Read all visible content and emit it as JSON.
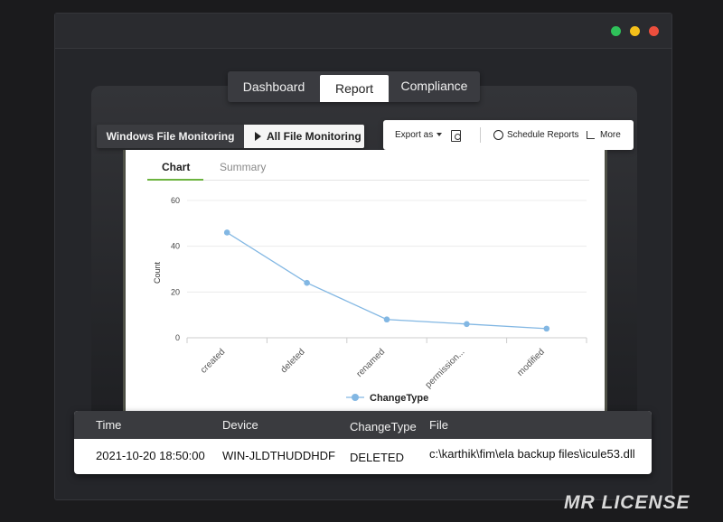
{
  "tabs": [
    {
      "label": "Dashboard",
      "active": false
    },
    {
      "label": "Report",
      "active": true
    },
    {
      "label": "Compliance",
      "active": false
    }
  ],
  "subtabs": {
    "windows_file_monitoring": "Windows File Monitoring",
    "all_file_monitoring": "All File Monitoring"
  },
  "toolbar": {
    "export_label": "Export as",
    "schedule_label": "Schedule Reports",
    "more_label": "More",
    "icons": [
      "pdf-icon",
      "clock-icon",
      "more-icon"
    ]
  },
  "chart_tabs": {
    "chart": "Chart",
    "summary": "Summary",
    "accent_color": "#6cb33f"
  },
  "chart_data": {
    "type": "line",
    "categories": [
      "created",
      "deleted",
      "renamed",
      "permission...",
      "modified"
    ],
    "series": [
      {
        "name": "ChangeType",
        "values": [
          46,
          24,
          8,
          6,
          4
        ],
        "color": "#82b7e3"
      }
    ],
    "xlabel": "",
    "ylabel": "Count",
    "ylim": [
      0,
      60
    ],
    "yticks": [
      0,
      20,
      40,
      60
    ],
    "grid": true,
    "legend": "bottom"
  },
  "table": {
    "headers": [
      "Time",
      "Device",
      "ChangeType",
      "File"
    ],
    "rows": [
      [
        "2021-10-20 18:50:00",
        "WIN-JLDTHUDDHDF",
        "DELETED",
        "c:\\karthik\\fim\\ela backup files\\icule53.dll"
      ]
    ]
  },
  "watermark": "MR LICENSE",
  "colors": {
    "window_dots": [
      "#2fc15a",
      "#f4c01a",
      "#ec4e3d"
    ]
  }
}
